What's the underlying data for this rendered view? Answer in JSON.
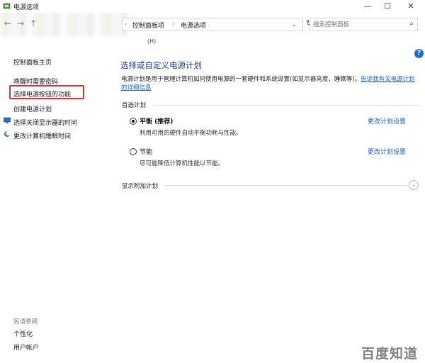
{
  "window": {
    "title": "电源选项",
    "minimize": "—",
    "maximize": "☐",
    "close": "✕"
  },
  "address": {
    "back": "←",
    "forward": "→",
    "up": "↑",
    "crumbs": [
      "控制面板项",
      "电源选项"
    ],
    "separator": "›",
    "dropdown": "⌄",
    "refresh": "↻"
  },
  "search": {
    "placeholder": "搜索控制面板",
    "icon": "⌕"
  },
  "menu_hint": "(H)",
  "help_icon": "?",
  "sidebar": {
    "home": "控制面板主页",
    "items": [
      {
        "label": "唤醒时需要密码"
      },
      {
        "label": "选择电源按钮的功能"
      },
      {
        "label": "创建电源计划"
      },
      {
        "label": "选择关闭显示器的时间"
      },
      {
        "label": "更改计算机睡眠时间"
      }
    ],
    "see_also_title": "另请参阅",
    "see_also": [
      {
        "label": "个性化"
      },
      {
        "label": "用户帐户"
      }
    ]
  },
  "main": {
    "title": "选择或自定义电源计划",
    "description": "电源计划是用于管理计算机如何使用电源的一套硬件和系统设置(如显示器亮度、睡眠等)。",
    "description_link": "告诉我有关电源计划的详细信息",
    "description_link_head": "告诉我有关",
    "selected_section": "首选计划",
    "plans": [
      {
        "name": "平衡 (推荐)",
        "description": "利用可用的硬件自动平衡功耗与性能。",
        "change": "更改计划设置",
        "selected": true
      },
      {
        "name": "节能",
        "description": "尽可能降低计算机性能以节能。",
        "change": "更改计划设置",
        "selected": false
      }
    ],
    "additional_section": "显示附加计划",
    "expand_icon": "⌄"
  },
  "watermark": "百度知道"
}
